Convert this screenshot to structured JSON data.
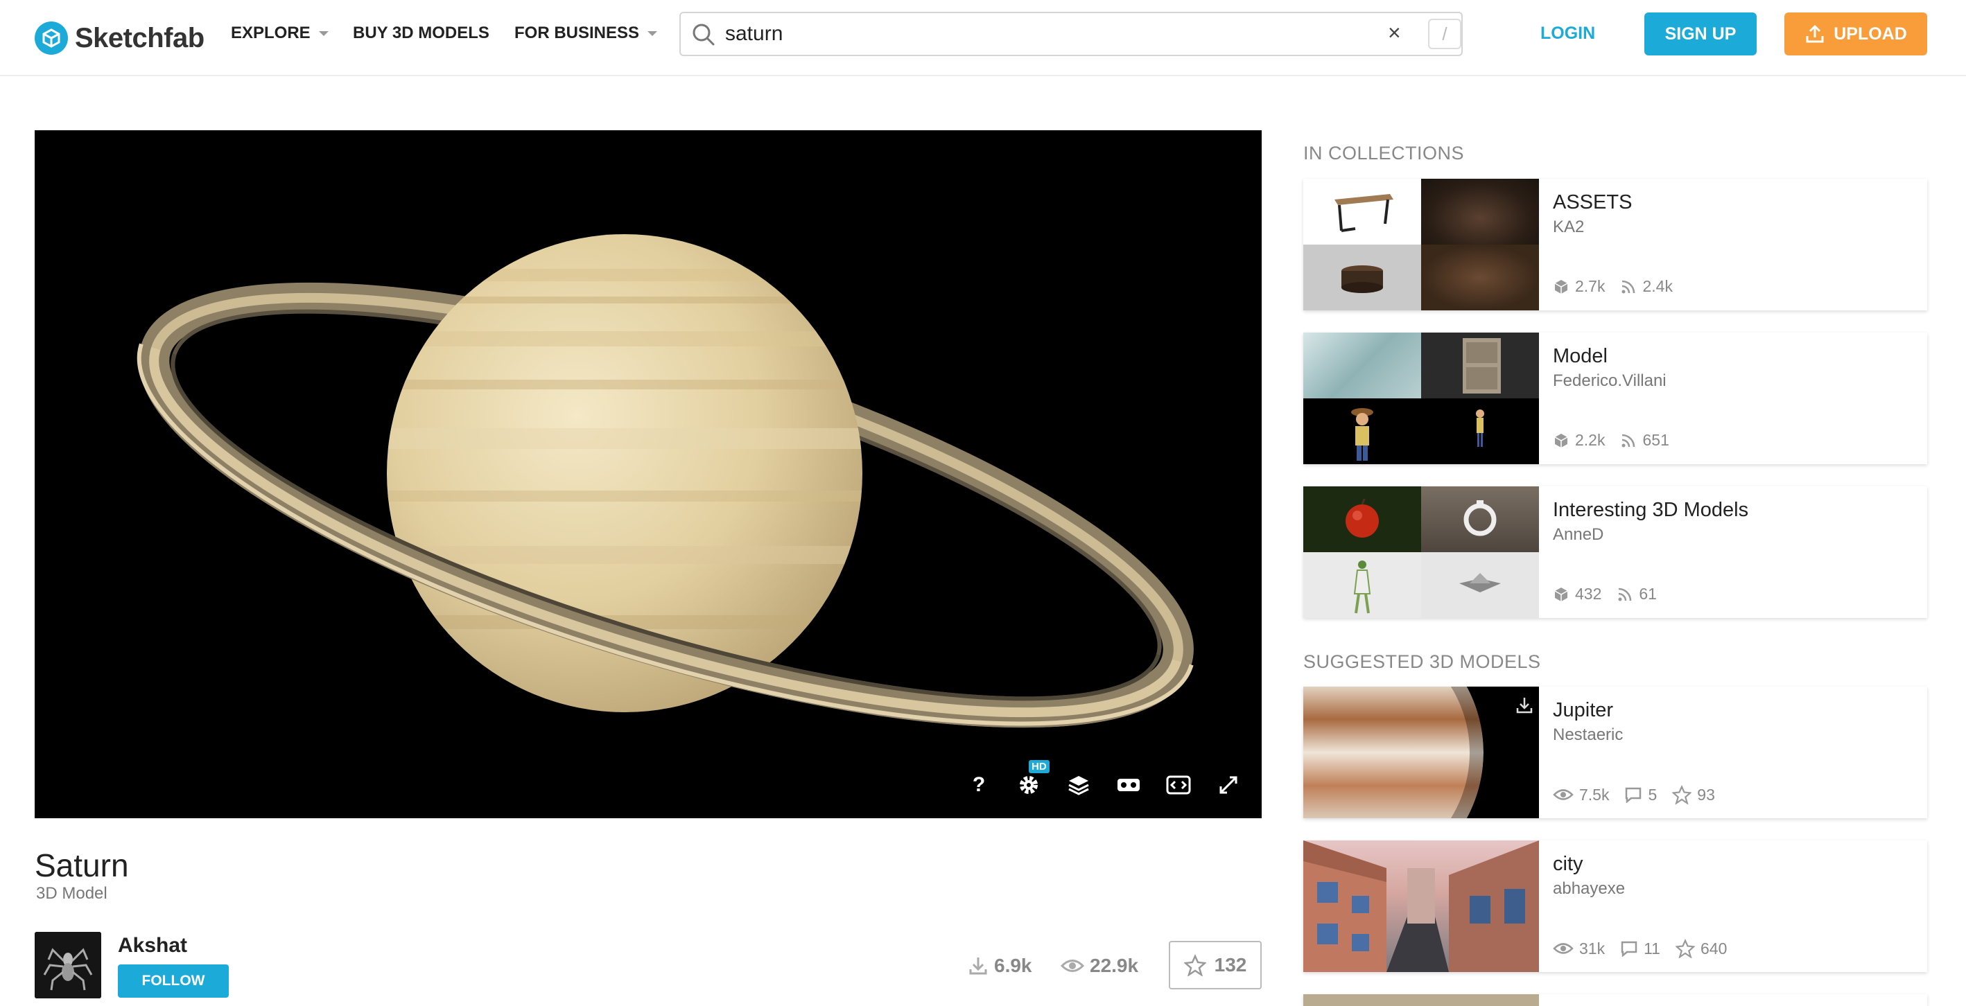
{
  "header": {
    "logo_text": "Sketchfab",
    "nav": {
      "explore": "EXPLORE",
      "buy": "BUY 3D MODELS",
      "business": "FOR BUSINESS"
    },
    "search": {
      "value": "saturn",
      "clear_symbol": "×",
      "shortcut": "/"
    },
    "login": "LOGIN",
    "signup": "SIGN UP",
    "upload": "UPLOAD",
    "colors": {
      "accent": "#1caad9",
      "upload": "#f89d3a"
    }
  },
  "viewer": {
    "controls": {
      "help": "?",
      "hd_badge": "HD"
    }
  },
  "model": {
    "title": "Saturn",
    "subtitle": "3D Model",
    "author": "Akshat",
    "follow_label": "FOLLOW",
    "downloads": "6.9k",
    "views": "22.9k",
    "likes": "132"
  },
  "collections": {
    "heading": "IN COLLECTIONS",
    "items": [
      {
        "title": "ASSETS",
        "author": "KA2",
        "models": "2.7k",
        "followers": "2.4k"
      },
      {
        "title": "Model",
        "author": "Federico.Villani",
        "models": "2.2k",
        "followers": "651"
      },
      {
        "title": "Interesting 3D Models",
        "author": "AnneD",
        "models": "432",
        "followers": "61"
      }
    ]
  },
  "suggested": {
    "heading": "SUGGESTED 3D MODELS",
    "items": [
      {
        "title": "Jupiter",
        "author": "Nestaeric",
        "views": "7.5k",
        "comments": "5",
        "likes": "93"
      },
      {
        "title": "city",
        "author": "abhayexe",
        "views": "31k",
        "comments": "11",
        "likes": "640"
      }
    ]
  }
}
